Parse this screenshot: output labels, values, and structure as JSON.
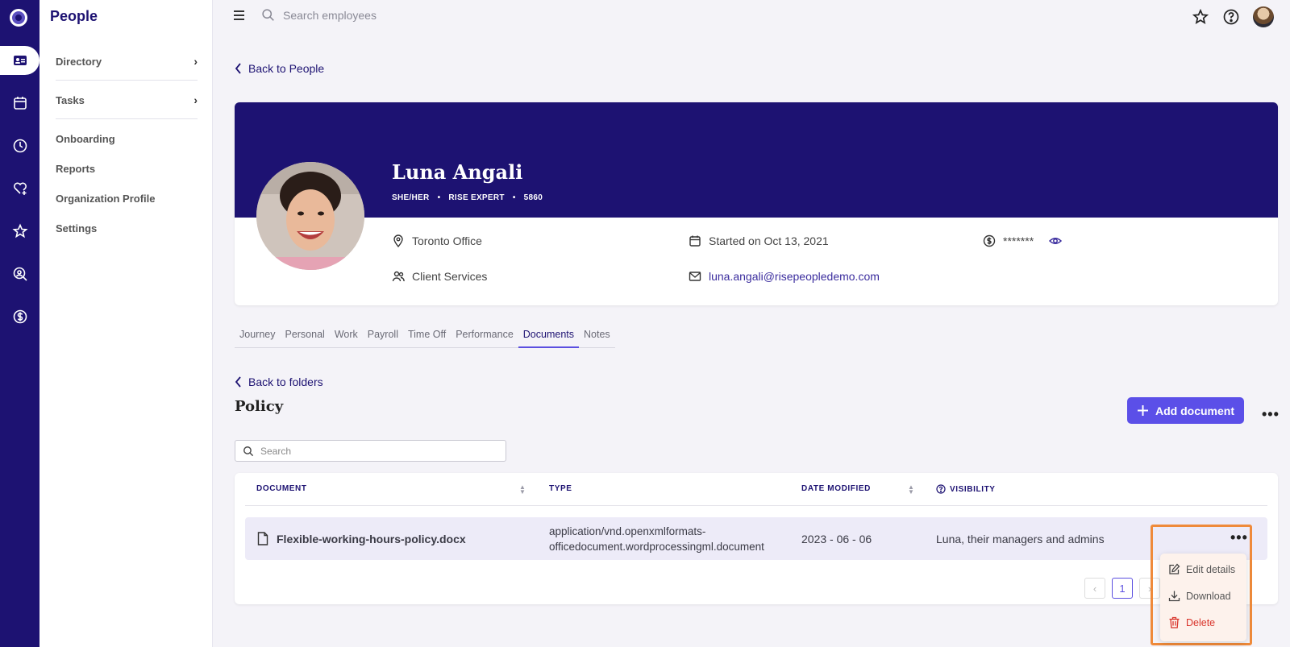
{
  "app": {
    "section_title": "People"
  },
  "sidebar": {
    "items": [
      {
        "label": "Directory",
        "has_chevron": true
      },
      {
        "label": "Tasks",
        "has_chevron": true
      },
      {
        "label": "Onboarding"
      },
      {
        "label": "Reports"
      },
      {
        "label": "Organization Profile"
      },
      {
        "label": "Settings"
      }
    ]
  },
  "topbar": {
    "search_placeholder": "Search employees"
  },
  "back_to_people": "Back to People",
  "profile": {
    "name": "Luna Angali",
    "pronouns": "SHE/HER",
    "role": "RISE EXPERT",
    "employee_id": "5860",
    "separator": "•",
    "location": "Toronto Office",
    "department": "Client Services",
    "start_date": "Started on Oct 13, 2021",
    "email": "luna.angali@risepeopledemo.com",
    "salary_masked": "*******"
  },
  "tabs": [
    {
      "label": "Journey"
    },
    {
      "label": "Personal"
    },
    {
      "label": "Work"
    },
    {
      "label": "Payroll"
    },
    {
      "label": "Time Off"
    },
    {
      "label": "Performance"
    },
    {
      "label": "Documents",
      "active": true
    },
    {
      "label": "Notes"
    }
  ],
  "documents": {
    "back_to_folders": "Back to folders",
    "folder_title": "Policy",
    "add_button": "Add document",
    "search_placeholder": "Search",
    "columns": {
      "document": "DOCUMENT",
      "type": "TYPE",
      "date_modified": "DATE MODIFIED",
      "visibility": "VISIBILITY"
    },
    "rows": [
      {
        "name": "Flexible-working-hours-policy.docx",
        "type_line1": "application/vnd.openxmlformats-",
        "type_line2": "officedocument.wordprocessingml.document",
        "date": "2023 - 06 - 06",
        "visibility": "Luna, their managers and admins"
      }
    ],
    "pagination": {
      "current_page": "1",
      "prev": "‹",
      "next": "›"
    },
    "row_menu": {
      "edit": "Edit details",
      "download": "Download",
      "delete": "Delete"
    }
  },
  "colors": {
    "brand_dark": "#1d1272",
    "accent": "#5b4fe8",
    "danger": "#d9342b",
    "highlight": "#ef8a3a"
  },
  "icons": [
    "logo-icon",
    "contact-card-icon",
    "calendar-icon",
    "clock-icon",
    "heart-plus-icon",
    "star-icon",
    "search-person-icon",
    "dollar-icon",
    "menu-icon",
    "search-icon",
    "star-outline-icon",
    "help-icon",
    "location-icon",
    "people-icon",
    "calendar-small-icon",
    "mail-icon",
    "dollar-circle-icon",
    "eye-icon",
    "file-icon",
    "plus-icon",
    "edit-icon",
    "download-icon",
    "trash-icon",
    "question-circle-icon"
  ]
}
